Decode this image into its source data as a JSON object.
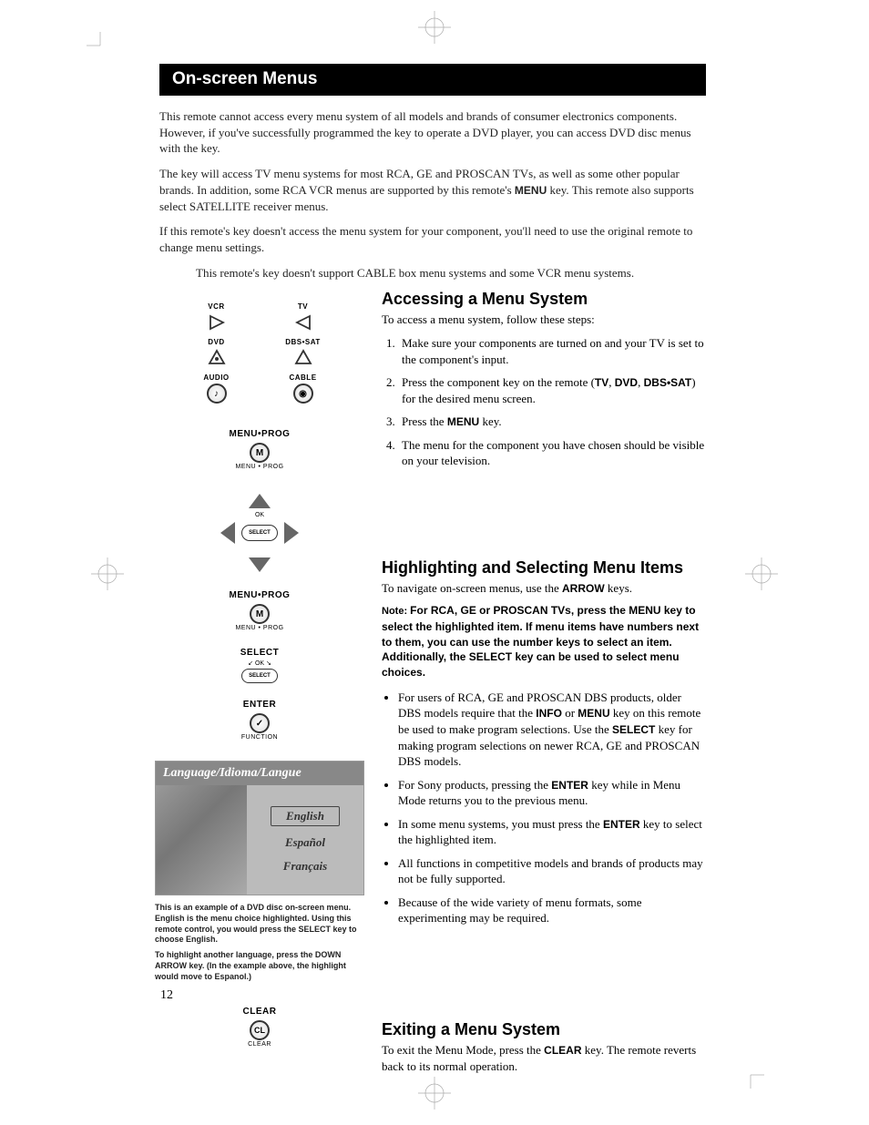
{
  "title": "On-screen Menus",
  "intro": {
    "p1a": "This remote cannot access every menu system of all models and brands of consumer electronics components. However, if you've successfully programmed the ",
    "p1b": " key to operate a DVD player, you can access DVD disc menus with the ",
    "p1c": " key.",
    "p2a": "The ",
    "p2b": " key will access TV menu systems for most RCA, GE and PROSCAN TVs, as well as some other popular brands. In addition, some RCA VCR menus are supported by this remote's ",
    "p2c": "MENU",
    "p2d": " key. This remote also supports select SATELLITE receiver menus.",
    "p3a": "If this remote's ",
    "p3b": " key doesn't access the menu system for your component, you'll need to use the original remote to change menu settings.",
    "p4a": "This remote's ",
    "p4b": " key doesn't support CABLE box menu systems and some VCR menu systems."
  },
  "remote_labels": {
    "vcr": "VCR",
    "tv": "TV",
    "dvd": "DVD",
    "dbs": "DBS•SAT",
    "audio": "AUDIO",
    "cable": "CABLE",
    "menu_prog": "MENU•PROG",
    "menu_sub": "MENU • PROG",
    "select": "SELECT",
    "ok": "OK",
    "enter": "ENTER",
    "function_sub": "FUNCTION",
    "clear": "CLEAR",
    "clear_sub": "CLEAR"
  },
  "access": {
    "title": "Accessing a Menu System",
    "lead": "To access a menu system, follow these steps:",
    "steps": [
      "Make sure your components are turned on and your TV is set to the component's input.",
      "Press the component key on the remote (TV, DVD, DBS•SAT) for the desired menu screen.",
      "Press the MENU key.",
      "The menu for the component you have chosen should be visible on your television."
    ],
    "step2a": "Press the component key on the remote (",
    "step2_tv": "TV",
    "step2_comma1": ", ",
    "step2_dvd": "DVD",
    "step2_comma2": ", ",
    "step2_dbs": "DBS•SAT",
    "step2b": ") for the desired menu screen.",
    "step3a": "Press the ",
    "step3_menu": "MENU",
    "step3b": " key."
  },
  "highlight": {
    "title": "Highlighting and Selecting Menu Items",
    "lead_a": "To navigate on-screen menus, use the ",
    "lead_arrow": "ARROW",
    "lead_b": " keys.",
    "note_label": "Note: ",
    "note_body": "For RCA, GE or PROSCAN TVs, press the MENU key to select the highlighted item. If menu items have numbers next to them, you can use the number keys to select an item. Additionally, the SELECT key can be used to select menu choices.",
    "b1a": "For users of RCA, GE and PROSCAN DBS products, older DBS models require that the ",
    "b1_info": "INFO",
    "b1_or": " or ",
    "b1_menu": "MENU",
    "b1b": " key on this remote be used to make program selections. Use the ",
    "b1_select": "SELECT",
    "b1c": " key for making program selections on newer RCA, GE and PROSCAN DBS models.",
    "b2a": "For Sony products, pressing the ",
    "b2_enter": "ENTER",
    "b2b": " key while in Menu Mode returns you to the previous menu.",
    "b3a": "In some menu systems, you must press the ",
    "b3_enter": "ENTER",
    "b3b": " key to select the highlighted item.",
    "b4": "All functions in competitive models and brands of products may not be fully supported.",
    "b5": "Because of the wide variety of menu formats, some experimenting may be required."
  },
  "dvd_menu": {
    "header": "Language/Idioma/Langue",
    "options": [
      "English",
      "Español",
      "Français"
    ],
    "selected": "English"
  },
  "caption": {
    "p1": "This is an example of a DVD disc on-screen menu. English is the menu choice highlighted. Using this remote control, you would press the SELECT key to choose English.",
    "p2": "To highlight another language, press the DOWN ARROW key. (In the example above, the highlight would move to Espanol.)"
  },
  "exit": {
    "title": "Exiting a Menu System",
    "body_a": "To exit the Menu Mode, press the ",
    "body_clear": "CLEAR",
    "body_b": " key. The remote reverts back to its normal operation."
  },
  "page_number": "12"
}
